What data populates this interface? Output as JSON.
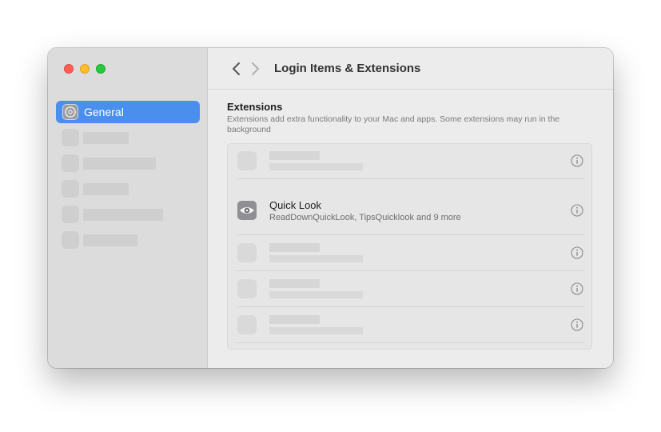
{
  "window": {
    "title": "Login Items & Extensions"
  },
  "sidebar": {
    "items": [
      {
        "label": "General",
        "icon": "gear-icon",
        "active": true
      }
    ]
  },
  "main": {
    "section_title": "Extensions",
    "section_description": "Extensions add extra functionality to your Mac and apps. Some extensions may run in the background",
    "extensions": [
      {
        "name": "Quick Look",
        "detail": "ReadDownQuickLook, TipsQuicklook and 9 more",
        "icon": "eye-icon"
      }
    ]
  },
  "colors": {
    "accent": "#4a8fee",
    "sidebar_bg": "#dcdcdc",
    "content_bg": "#ececec"
  }
}
